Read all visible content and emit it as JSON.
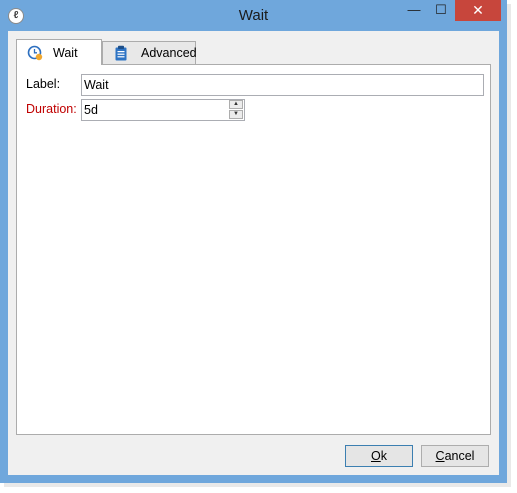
{
  "window": {
    "title": "Wait",
    "app_icon": "app-logo-icon"
  },
  "controls": {
    "minimize": "—",
    "maximize": "☐",
    "close": "✕"
  },
  "tabs": [
    {
      "label": "Wait",
      "icon": "clock-icon",
      "active": true
    },
    {
      "label": "Advanced",
      "icon": "clipboard-icon",
      "active": false
    }
  ],
  "form": {
    "label_caption": "Label:",
    "label_value": "Wait",
    "duration_caption": "Duration:",
    "duration_value": "5d"
  },
  "buttons": {
    "ok_prefix": "O",
    "ok_rest": "k",
    "cancel_prefix": "C",
    "cancel_rest": "ancel"
  },
  "colors": {
    "titlebar": "#6fa7dc",
    "close": "#c7463c",
    "required_label": "#c00000"
  }
}
